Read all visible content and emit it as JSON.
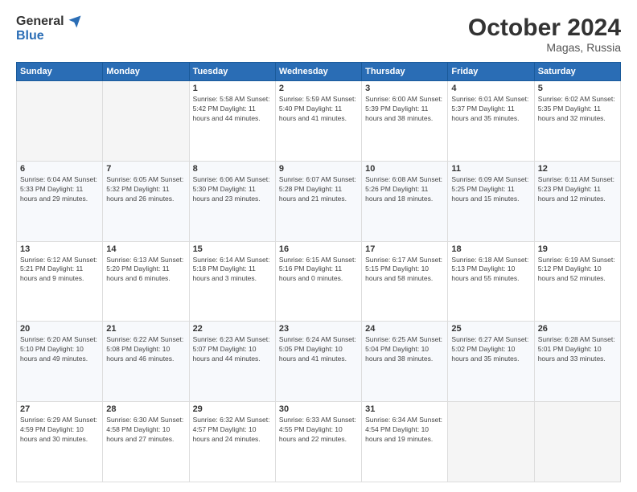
{
  "header": {
    "logo_general": "General",
    "logo_blue": "Blue",
    "month_title": "October 2024",
    "location": "Magas, Russia"
  },
  "calendar": {
    "days_of_week": [
      "Sunday",
      "Monday",
      "Tuesday",
      "Wednesday",
      "Thursday",
      "Friday",
      "Saturday"
    ],
    "weeks": [
      [
        {
          "day": "",
          "info": ""
        },
        {
          "day": "",
          "info": ""
        },
        {
          "day": "1",
          "info": "Sunrise: 5:58 AM\nSunset: 5:42 PM\nDaylight: 11 hours and 44 minutes."
        },
        {
          "day": "2",
          "info": "Sunrise: 5:59 AM\nSunset: 5:40 PM\nDaylight: 11 hours and 41 minutes."
        },
        {
          "day": "3",
          "info": "Sunrise: 6:00 AM\nSunset: 5:39 PM\nDaylight: 11 hours and 38 minutes."
        },
        {
          "day": "4",
          "info": "Sunrise: 6:01 AM\nSunset: 5:37 PM\nDaylight: 11 hours and 35 minutes."
        },
        {
          "day": "5",
          "info": "Sunrise: 6:02 AM\nSunset: 5:35 PM\nDaylight: 11 hours and 32 minutes."
        }
      ],
      [
        {
          "day": "6",
          "info": "Sunrise: 6:04 AM\nSunset: 5:33 PM\nDaylight: 11 hours and 29 minutes."
        },
        {
          "day": "7",
          "info": "Sunrise: 6:05 AM\nSunset: 5:32 PM\nDaylight: 11 hours and 26 minutes."
        },
        {
          "day": "8",
          "info": "Sunrise: 6:06 AM\nSunset: 5:30 PM\nDaylight: 11 hours and 23 minutes."
        },
        {
          "day": "9",
          "info": "Sunrise: 6:07 AM\nSunset: 5:28 PM\nDaylight: 11 hours and 21 minutes."
        },
        {
          "day": "10",
          "info": "Sunrise: 6:08 AM\nSunset: 5:26 PM\nDaylight: 11 hours and 18 minutes."
        },
        {
          "day": "11",
          "info": "Sunrise: 6:09 AM\nSunset: 5:25 PM\nDaylight: 11 hours and 15 minutes."
        },
        {
          "day": "12",
          "info": "Sunrise: 6:11 AM\nSunset: 5:23 PM\nDaylight: 11 hours and 12 minutes."
        }
      ],
      [
        {
          "day": "13",
          "info": "Sunrise: 6:12 AM\nSunset: 5:21 PM\nDaylight: 11 hours and 9 minutes."
        },
        {
          "day": "14",
          "info": "Sunrise: 6:13 AM\nSunset: 5:20 PM\nDaylight: 11 hours and 6 minutes."
        },
        {
          "day": "15",
          "info": "Sunrise: 6:14 AM\nSunset: 5:18 PM\nDaylight: 11 hours and 3 minutes."
        },
        {
          "day": "16",
          "info": "Sunrise: 6:15 AM\nSunset: 5:16 PM\nDaylight: 11 hours and 0 minutes."
        },
        {
          "day": "17",
          "info": "Sunrise: 6:17 AM\nSunset: 5:15 PM\nDaylight: 10 hours and 58 minutes."
        },
        {
          "day": "18",
          "info": "Sunrise: 6:18 AM\nSunset: 5:13 PM\nDaylight: 10 hours and 55 minutes."
        },
        {
          "day": "19",
          "info": "Sunrise: 6:19 AM\nSunset: 5:12 PM\nDaylight: 10 hours and 52 minutes."
        }
      ],
      [
        {
          "day": "20",
          "info": "Sunrise: 6:20 AM\nSunset: 5:10 PM\nDaylight: 10 hours and 49 minutes."
        },
        {
          "day": "21",
          "info": "Sunrise: 6:22 AM\nSunset: 5:08 PM\nDaylight: 10 hours and 46 minutes."
        },
        {
          "day": "22",
          "info": "Sunrise: 6:23 AM\nSunset: 5:07 PM\nDaylight: 10 hours and 44 minutes."
        },
        {
          "day": "23",
          "info": "Sunrise: 6:24 AM\nSunset: 5:05 PM\nDaylight: 10 hours and 41 minutes."
        },
        {
          "day": "24",
          "info": "Sunrise: 6:25 AM\nSunset: 5:04 PM\nDaylight: 10 hours and 38 minutes."
        },
        {
          "day": "25",
          "info": "Sunrise: 6:27 AM\nSunset: 5:02 PM\nDaylight: 10 hours and 35 minutes."
        },
        {
          "day": "26",
          "info": "Sunrise: 6:28 AM\nSunset: 5:01 PM\nDaylight: 10 hours and 33 minutes."
        }
      ],
      [
        {
          "day": "27",
          "info": "Sunrise: 6:29 AM\nSunset: 4:59 PM\nDaylight: 10 hours and 30 minutes."
        },
        {
          "day": "28",
          "info": "Sunrise: 6:30 AM\nSunset: 4:58 PM\nDaylight: 10 hours and 27 minutes."
        },
        {
          "day": "29",
          "info": "Sunrise: 6:32 AM\nSunset: 4:57 PM\nDaylight: 10 hours and 24 minutes."
        },
        {
          "day": "30",
          "info": "Sunrise: 6:33 AM\nSunset: 4:55 PM\nDaylight: 10 hours and 22 minutes."
        },
        {
          "day": "31",
          "info": "Sunrise: 6:34 AM\nSunset: 4:54 PM\nDaylight: 10 hours and 19 minutes."
        },
        {
          "day": "",
          "info": ""
        },
        {
          "day": "",
          "info": ""
        }
      ]
    ]
  }
}
